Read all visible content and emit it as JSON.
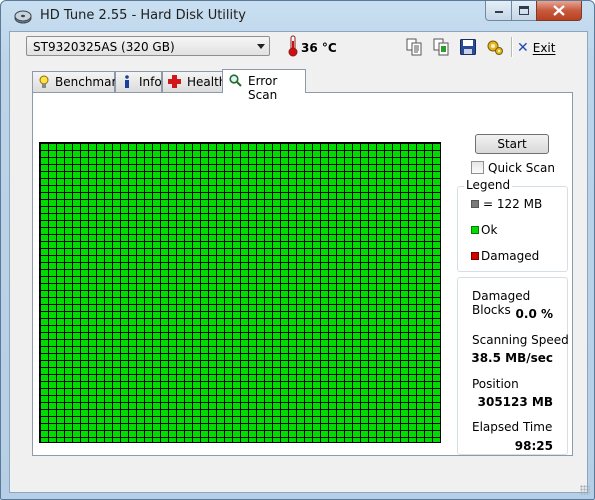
{
  "window": {
    "title": "HD Tune 2.55 - Hard Disk Utility",
    "icons": {
      "app": "disk-icon",
      "minimize": "minimize-icon",
      "maximize": "maximize-icon",
      "close": "close-icon"
    }
  },
  "toolbar": {
    "drive": "ST9320325AS (320 GB)",
    "temperature": "36 °C",
    "icons": [
      "copy-text-icon",
      "copy-screenshot-icon",
      "save-icon",
      "options-icon"
    ],
    "exit_label": "Exit"
  },
  "tabs": [
    {
      "label": "Benchmark",
      "icon": "lightbulb-icon",
      "active": false
    },
    {
      "label": "Info",
      "icon": "info-icon",
      "active": false
    },
    {
      "label": "Health",
      "icon": "health-cross-icon",
      "active": false
    },
    {
      "label": "Error Scan",
      "icon": "magnifier-icon",
      "active": true
    }
  ],
  "error_scan": {
    "start_label": "Start",
    "quick_scan_label": "Quick Scan",
    "quick_scan_checked": false,
    "legend": {
      "title": "Legend",
      "block_size": "= 122 MB",
      "ok": "Ok",
      "damaged": "Damaged"
    },
    "stats": {
      "damaged_blocks_label": "Damaged Blocks",
      "damaged_blocks_value": "0.0 %",
      "scanning_speed_label": "Scanning Speed",
      "scanning_speed_value": "38.5 MB/sec",
      "position_label": "Position",
      "position_value": "305123 MB",
      "elapsed_label": "Elapsed Time",
      "elapsed_value": "98:25"
    },
    "colors": {
      "ok": "#00dc00",
      "damaged": "#d40000",
      "block": "#7a7a7a"
    },
    "grid_state": "all blocks ok"
  }
}
